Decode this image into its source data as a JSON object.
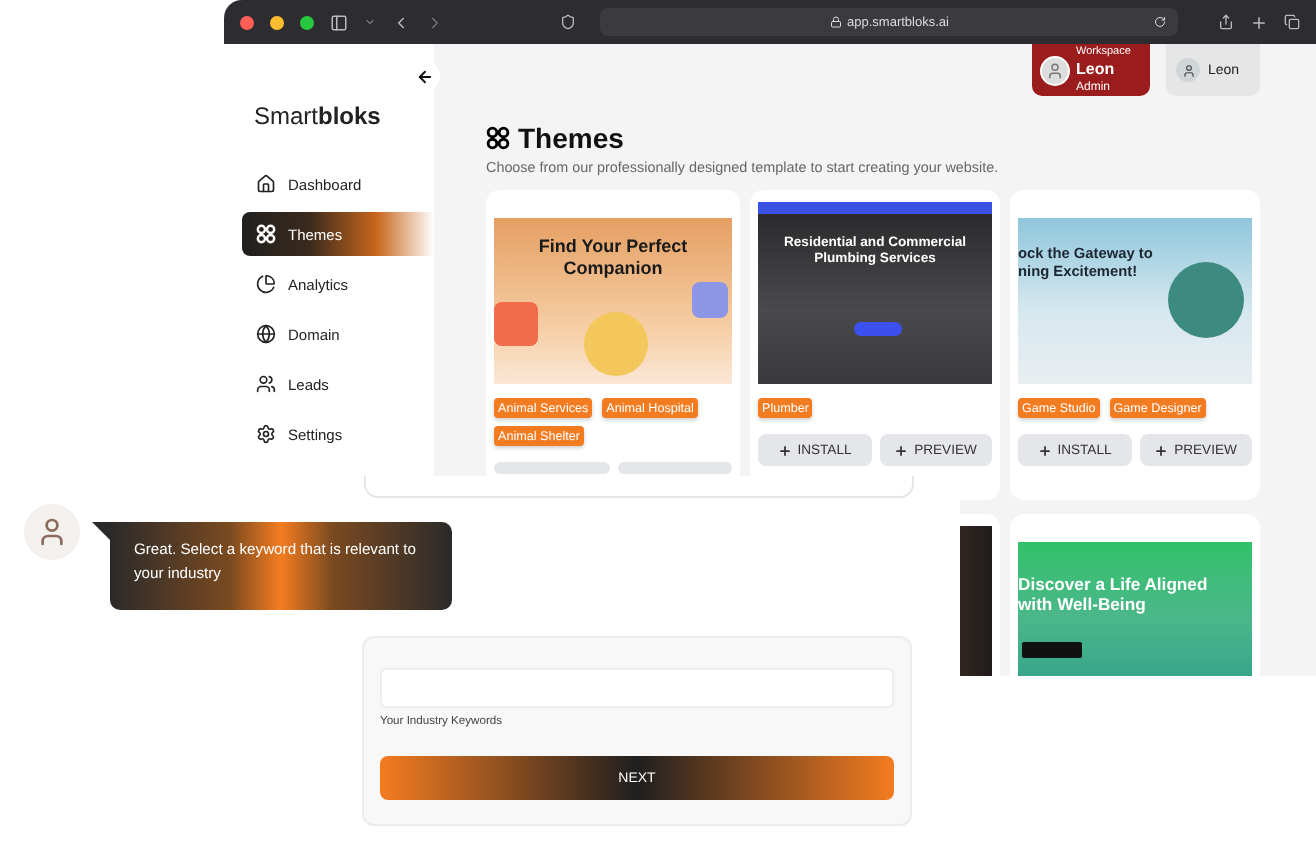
{
  "browser": {
    "url": "app.smartbloks.ai"
  },
  "workspace": {
    "caption": "Workspace",
    "name": "Leon",
    "role": "Admin"
  },
  "user": {
    "name": "Leon"
  },
  "sidebar": {
    "logo": "Smart**bloks**",
    "items": [
      {
        "label": "Dashboard",
        "selected": false
      },
      {
        "label": "Themes",
        "selected": true
      },
      {
        "label": "Analytics",
        "selected": false
      },
      {
        "label": "Domain",
        "selected": false
      },
      {
        "label": "Leads",
        "selected": false
      },
      {
        "label": "Settings",
        "selected": false
      }
    ]
  },
  "page": {
    "title": "Themes",
    "subtitle": "Choose from our professionally designed template to start creating your website."
  },
  "theme_rows": [
    [
      {
        "headline": "Find Your Perfect Companion",
        "tags": [
          "Animal Services",
          "Animal Hospital",
          "Animal Shelter"
        ],
        "actions": [
          {
            "kind": "covered"
          },
          {
            "kind": "covered"
          }
        ]
      },
      {
        "headline": "Residential and Commercial Plumbing Services",
        "tags": [
          "Plumber"
        ],
        "actions": [
          {
            "kind": "install",
            "label": "INSTALL"
          },
          {
            "kind": "preview",
            "label": "PREVIEW"
          }
        ]
      },
      {
        "headline": "ock the Gateway to ning Excitement!",
        "tags": [
          "Game Studio",
          "Game Designer"
        ],
        "actions": [
          {
            "kind": "install",
            "label": "INSTALL"
          },
          {
            "kind": "preview",
            "label": "PREVIEW"
          }
        ]
      }
    ],
    [
      {},
      {
        "headline": "Discover a Life Aligned with Well-Being"
      }
    ]
  ],
  "chat": {
    "message": "Great. Select a keyword that is relevant to your industry"
  },
  "keyword_form": {
    "label": "Your Industry Keywords",
    "button": "NEXT"
  }
}
